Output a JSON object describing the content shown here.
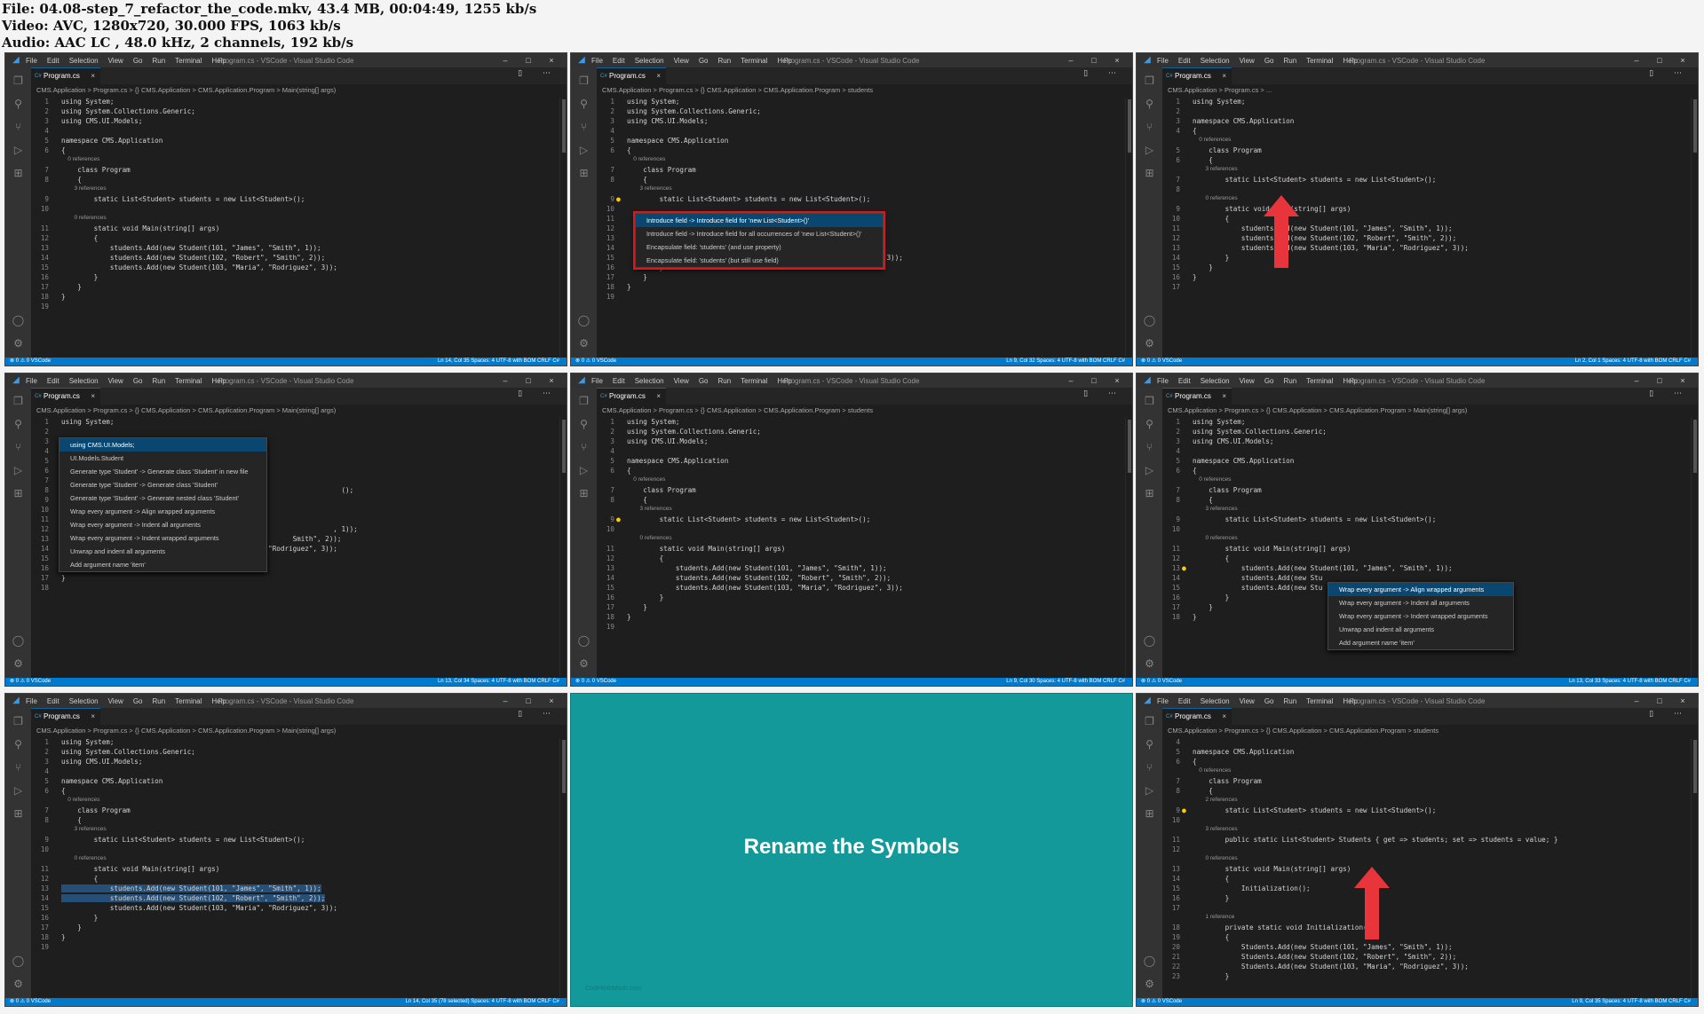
{
  "header": {
    "line1": "File: 04.08-step_7_refactor_the_code.mkv, 43.4 MB, 00:04:49, 1255 kb/s",
    "line2": "Video: AVC, 1280x720, 30.000 FPS, 1063 kb/s",
    "line3": "Audio: AAC LC , 48.0 kHz, 2 channels, 192 kb/s"
  },
  "vscode": {
    "menu": [
      "File",
      "Edit",
      "Selection",
      "View",
      "Go",
      "Run",
      "Terminal",
      "Help"
    ],
    "window_title": "Program.cs - VSCode - Visual Studio Code",
    "tab_label": "Program.cs",
    "tab_close": "×",
    "window_controls": [
      "–",
      "□",
      "×"
    ],
    "logo_glyph": "◢"
  },
  "activity_icons": [
    {
      "name": "explorer-icon",
      "glyph": "❐"
    },
    {
      "name": "search-icon",
      "glyph": "⚲"
    },
    {
      "name": "source-control-icon",
      "glyph": "⑂"
    },
    {
      "name": "run-debug-icon",
      "glyph": "▷"
    },
    {
      "name": "extensions-icon",
      "glyph": "⊞"
    }
  ],
  "activity_bottom": [
    {
      "name": "account-icon",
      "glyph": "◯"
    },
    {
      "name": "settings-gear-icon",
      "glyph": "⚙"
    }
  ],
  "tiles": [
    {
      "breadcrumb": "CMS.Application > Program.cs > {} CMS.Application > CMS.Application.Program > Main(string[] args)",
      "status_left": "⊗ 0 ⚠ 0   VSCode",
      "status_right": "Ln 14, Col 35   Spaces: 4   UTF-8 with BOM   CRLF   C#",
      "lines": [
        {
          "n": "1",
          "t": "using System;"
        },
        {
          "n": "2",
          "t": "using System.Collections.Generic;"
        },
        {
          "n": "3",
          "t": "using CMS.UI.Models;"
        },
        {
          "n": "4",
          "t": ""
        },
        {
          "n": "5",
          "t": "namespace CMS.Application"
        },
        {
          "n": "6",
          "t": "{"
        },
        {
          "n": "",
          "t": "    0 references",
          "ref": true
        },
        {
          "n": "7",
          "t": "    class Program"
        },
        {
          "n": "8",
          "t": "    {"
        },
        {
          "n": "",
          "t": "        3 references",
          "ref": true
        },
        {
          "n": "9",
          "t": "        static List<Student> students = new List<Student>();"
        },
        {
          "n": "10",
          "t": ""
        },
        {
          "n": "",
          "t": "        0 references",
          "ref": true
        },
        {
          "n": "11",
          "t": "        static void Main(string[] args)"
        },
        {
          "n": "12",
          "t": "        {"
        },
        {
          "n": "13",
          "t": "            students.Add(new Student(101, \"James\", \"Smith\", 1));"
        },
        {
          "n": "14",
          "t": "            students.Add(new Student(102, \"Robert\", \"Smith\", 2));"
        },
        {
          "n": "15",
          "t": "            students.Add(new Student(103, \"Maria\", \"Rodriguez\", 3));"
        },
        {
          "n": "16",
          "t": "        }"
        },
        {
          "n": "17",
          "t": "    }"
        },
        {
          "n": "18",
          "t": "}"
        },
        {
          "n": "19",
          "t": ""
        }
      ]
    },
    {
      "breadcrumb": "CMS.Application > Program.cs > {} CMS.Application > CMS.Application.Program > students",
      "status_left": "⊗ 0 ⚠ 0   VSCode",
      "status_right": "Ln 9, Col 32   Spaces: 4   UTF-8 with BOM   CRLF   C#",
      "lines": [
        {
          "n": "1",
          "t": "using System;"
        },
        {
          "n": "2",
          "t": "using System.Collections.Generic;"
        },
        {
          "n": "3",
          "t": "using CMS.UI.Models;"
        },
        {
          "n": "4",
          "t": ""
        },
        {
          "n": "5",
          "t": "namespace CMS.Application"
        },
        {
          "n": "6",
          "t": "{"
        },
        {
          "n": "",
          "t": "    0 references",
          "ref": true
        },
        {
          "n": "7",
          "t": "    class Program"
        },
        {
          "n": "8",
          "t": "    {"
        },
        {
          "n": "",
          "t": "        3 references",
          "ref": true
        },
        {
          "n": "9",
          "t": "        static List<Student> students = new List<Student>();",
          "bulb": true
        },
        {
          "n": "10",
          "t": ""
        },
        {
          "n": "11",
          "t": ""
        },
        {
          "n": "12",
          "t": ""
        },
        {
          "n": "13",
          "t": ""
        },
        {
          "n": "14",
          "t": ""
        },
        {
          "n": "15",
          "t": "            students.Add(new Student(103, \"Maria\", \"Rodriguez\", 3));"
        },
        {
          "n": "16",
          "t": "        }"
        },
        {
          "n": "17",
          "t": "    }"
        },
        {
          "n": "18",
          "t": "}"
        },
        {
          "n": "19",
          "t": ""
        }
      ],
      "menu": [
        "Introduce field -> Introduce field for 'new List<Student>()'",
        "Introduce field -> Introduce field for all occurrences of 'new List<Student>()'",
        "Encapsulate field: 'students' (and use property)",
        "Encapsulate field: 'students' (but still use field)"
      ]
    },
    {
      "breadcrumb": "CMS.Application > Program.cs > ...",
      "status_left": "⊗ 0 ⚠ 0   VSCode",
      "status_right": "Ln 2, Col 1   Spaces: 4   UTF-8 with BOM   CRLF   C#",
      "lines": [
        {
          "n": "1",
          "t": "using System;"
        },
        {
          "n": "2",
          "t": ""
        },
        {
          "n": "3",
          "t": "namespace CMS.Application"
        },
        {
          "n": "4",
          "t": "{"
        },
        {
          "n": "",
          "t": "    0 references",
          "ref": true
        },
        {
          "n": "5",
          "t": "    class Program"
        },
        {
          "n": "6",
          "t": "    {"
        },
        {
          "n": "",
          "t": "        3 references",
          "ref": true
        },
        {
          "n": "7",
          "t": "        static List<Student> students = new List<Student>();"
        },
        {
          "n": "8",
          "t": ""
        },
        {
          "n": "",
          "t": "        0 references",
          "ref": true
        },
        {
          "n": "9",
          "t": "        static void Main(string[] args)"
        },
        {
          "n": "10",
          "t": "        {"
        },
        {
          "n": "11",
          "t": "            students.Add(new Student(101, \"James\", \"Smith\", 1));"
        },
        {
          "n": "12",
          "t": "            students.Add(new Student(102, \"Robert\", \"Smith\", 2));"
        },
        {
          "n": "13",
          "t": "            students.Add(new Student(103, \"Maria\", \"Rodriguez\", 3));"
        },
        {
          "n": "14",
          "t": "        }"
        },
        {
          "n": "15",
          "t": "    }"
        },
        {
          "n": "16",
          "t": "}"
        },
        {
          "n": "17",
          "t": ""
        }
      ]
    },
    {
      "breadcrumb": "CMS.Application > Program.cs > {} CMS.Application > CMS.Application.Program > Main(string[] args)",
      "status_left": "⊗ 0 ⚠ 0   VSCode",
      "status_right": "Ln 13, Col 34   Spaces: 4   UTF-8 with BOM   CRLF   C#",
      "lines": [
        {
          "n": "1",
          "t": "using System;"
        },
        {
          "n": "2",
          "t": ""
        },
        {
          "n": "3",
          "t": ""
        },
        {
          "n": "4",
          "t": ""
        },
        {
          "n": "5",
          "t": ""
        },
        {
          "n": "6",
          "t": ""
        },
        {
          "n": "7",
          "t": ""
        },
        {
          "n": "8",
          "t": "                                                                     ();"
        },
        {
          "n": "9",
          "t": ""
        },
        {
          "n": "10",
          "t": ""
        },
        {
          "n": "11",
          "t": ""
        },
        {
          "n": "12",
          "t": "                                                                   , 1));"
        },
        {
          "n": "13",
          "t": "                                                         Smith\", 2));"
        },
        {
          "n": "14",
          "t": "            students.Add(new Student(103, \"Maria\", \"Rodriguez\", 3));"
        },
        {
          "n": "15",
          "t": "        }"
        },
        {
          "n": "16",
          "t": "    }"
        },
        {
          "n": "17",
          "t": "}"
        },
        {
          "n": "18",
          "t": ""
        }
      ],
      "menu": [
        "using CMS.UI.Models;",
        "UI.Models.Student",
        "Generate type 'Student' -> Generate class 'Student' in new file",
        "Generate type 'Student' -> Generate class 'Student'",
        "Generate type 'Student' -> Generate nested class 'Student'",
        "Wrap every argument -> Align wrapped arguments",
        "Wrap every argument -> Indent all arguments",
        "Wrap every argument -> Indent wrapped arguments",
        "Unwrap and indent all arguments",
        "Add argument name 'item'"
      ]
    },
    {
      "breadcrumb": "CMS.Application > Program.cs > {} CMS.Application > CMS.Application.Program > students",
      "status_left": "⊗ 0 ⚠ 0   VSCode",
      "status_right": "Ln 9, Col 30   Spaces: 4   UTF-8 with BOM   CRLF   C#",
      "lines": [
        {
          "n": "1",
          "t": "using System;"
        },
        {
          "n": "2",
          "t": "using System.Collections.Generic;"
        },
        {
          "n": "3",
          "t": "using CMS.UI.Models;"
        },
        {
          "n": "4",
          "t": ""
        },
        {
          "n": "5",
          "t": "namespace CMS.Application"
        },
        {
          "n": "6",
          "t": "{"
        },
        {
          "n": "",
          "t": "    0 references",
          "ref": true
        },
        {
          "n": "7",
          "t": "    class Program"
        },
        {
          "n": "8",
          "t": "    {"
        },
        {
          "n": "",
          "t": "        3 references",
          "ref": true
        },
        {
          "n": "9",
          "t": "        static List<Student> students = new List<Student>();",
          "bulb": true
        },
        {
          "n": "10",
          "t": ""
        },
        {
          "n": "",
          "t": "        0 references",
          "ref": true
        },
        {
          "n": "11",
          "t": "        static void Main(string[] args)"
        },
        {
          "n": "12",
          "t": "        {"
        },
        {
          "n": "13",
          "t": "            students.Add(new Student(101, \"James\", \"Smith\", 1));"
        },
        {
          "n": "14",
          "t": "            students.Add(new Student(102, \"Robert\", \"Smith\", 2));"
        },
        {
          "n": "15",
          "t": "            students.Add(new Student(103, \"Maria\", \"Rodriguez\", 3));"
        },
        {
          "n": "16",
          "t": "        }"
        },
        {
          "n": "17",
          "t": "    }"
        },
        {
          "n": "18",
          "t": "}"
        },
        {
          "n": "19",
          "t": ""
        }
      ]
    },
    {
      "breadcrumb": "CMS.Application > Program.cs > {} CMS.Application > CMS.Application.Program > Main(string[] args)",
      "status_left": "⊗ 0 ⚠ 0   VSCode",
      "status_right": "Ln 13, Col 33   Spaces: 4   UTF-8 with BOM   CRLF   C#",
      "lines": [
        {
          "n": "1",
          "t": "using System;"
        },
        {
          "n": "2",
          "t": "using System.Collections.Generic;"
        },
        {
          "n": "3",
          "t": "using CMS.UI.Models;"
        },
        {
          "n": "4",
          "t": ""
        },
        {
          "n": "5",
          "t": "namespace CMS.Application"
        },
        {
          "n": "6",
          "t": "{"
        },
        {
          "n": "",
          "t": "    0 references",
          "ref": true
        },
        {
          "n": "7",
          "t": "    class Program"
        },
        {
          "n": "8",
          "t": "    {"
        },
        {
          "n": "",
          "t": "        3 references",
          "ref": true
        },
        {
          "n": "9",
          "t": "        static List<Student> students = new List<Student>();"
        },
        {
          "n": "10",
          "t": ""
        },
        {
          "n": "",
          "t": "        0 references",
          "ref": true
        },
        {
          "n": "11",
          "t": "        static void Main(string[] args)"
        },
        {
          "n": "12",
          "t": "        {"
        },
        {
          "n": "13",
          "t": "            students.Add(new Student(101, \"James\", \"Smith\", 1));",
          "bulb": true
        },
        {
          "n": "14",
          "t": "            students.Add(new Stu"
        },
        {
          "n": "15",
          "t": "            students.Add(new Stu"
        },
        {
          "n": "16",
          "t": "        }"
        },
        {
          "n": "17",
          "t": "    }"
        },
        {
          "n": "18",
          "t": "}"
        }
      ],
      "menu": [
        "Wrap every argument -> Align wrapped arguments",
        "Wrap every argument -> Indent all arguments",
        "Wrap every argument -> Indent wrapped arguments",
        "Unwrap and indent all arguments",
        "Add argument name 'item'"
      ]
    },
    {
      "breadcrumb": "CMS.Application > Program.cs > {} CMS.Application > CMS.Application.Program > Main(string[] args)",
      "status_left": "⊗ 0 ⚠ 0   VSCode",
      "status_right": "Ln 14, Col 35 (78 selected)   Spaces: 4   UTF-8 with BOM   CRLF   C#",
      "lines": [
        {
          "n": "1",
          "t": "using System;"
        },
        {
          "n": "2",
          "t": "using System.Collections.Generic;"
        },
        {
          "n": "3",
          "t": "using CMS.UI.Models;"
        },
        {
          "n": "4",
          "t": ""
        },
        {
          "n": "5",
          "t": "namespace CMS.Application"
        },
        {
          "n": "6",
          "t": "{"
        },
        {
          "n": "",
          "t": "    0 references",
          "ref": true
        },
        {
          "n": "7",
          "t": "    class Program"
        },
        {
          "n": "8",
          "t": "    {"
        },
        {
          "n": "",
          "t": "        3 references",
          "ref": true
        },
        {
          "n": "9",
          "t": "        static List<Student> students = new List<Student>();"
        },
        {
          "n": "10",
          "t": ""
        },
        {
          "n": "",
          "t": "        0 references",
          "ref": true
        },
        {
          "n": "11",
          "t": "        static void Main(string[] args)"
        },
        {
          "n": "12",
          "t": "        {"
        },
        {
          "n": "13",
          "t": "            students.Add(new Student(101, \"James\", \"Smith\", 1));",
          "sel": true
        },
        {
          "n": "14",
          "t": "            students.Add(new Student(102, \"Robert\", \"Smith\", 2));",
          "sel": true
        },
        {
          "n": "15",
          "t": "            students.Add(new Student(103, \"Maria\", \"Rodriguez\", 3));"
        },
        {
          "n": "16",
          "t": "        }"
        },
        {
          "n": "17",
          "t": "    }"
        },
        {
          "n": "18",
          "t": "}"
        },
        {
          "n": "19",
          "t": ""
        }
      ]
    },
    {
      "title": "Rename the Symbols",
      "footer": "CodeWithMosh.com"
    },
    {
      "breadcrumb": "CMS.Application > Program.cs > {} CMS.Application > CMS.Application.Program > students",
      "status_left": "⊗ 0 ⚠ 0   VSCode",
      "status_right": "Ln 9, Col 35   Spaces: 4   UTF-8 with BOM   CRLF   C#",
      "lines": [
        {
          "n": "4",
          "t": ""
        },
        {
          "n": "5",
          "t": "namespace CMS.Application"
        },
        {
          "n": "6",
          "t": "{"
        },
        {
          "n": "",
          "t": "    0 references",
          "ref": true
        },
        {
          "n": "7",
          "t": "    class Program"
        },
        {
          "n": "8",
          "t": "    {"
        },
        {
          "n": "",
          "t": "        2 references",
          "ref": true
        },
        {
          "n": "9",
          "t": "        static List<Student> students = new List<Student>();",
          "bulb": true
        },
        {
          "n": "10",
          "t": ""
        },
        {
          "n": "",
          "t": "        3 references",
          "ref": true
        },
        {
          "n": "11",
          "t": "        public static List<Student> Students { get => students; set => students = value; }"
        },
        {
          "n": "12",
          "t": ""
        },
        {
          "n": "",
          "t": "        0 references",
          "ref": true
        },
        {
          "n": "13",
          "t": "        static void Main(string[] args)"
        },
        {
          "n": "14",
          "t": "        {"
        },
        {
          "n": "15",
          "t": "            Initialization();"
        },
        {
          "n": "16",
          "t": "        }"
        },
        {
          "n": "17",
          "t": ""
        },
        {
          "n": "",
          "t": "        1 reference",
          "ref": true
        },
        {
          "n": "18",
          "t": "        private static void Initialization()"
        },
        {
          "n": "19",
          "t": "        {"
        },
        {
          "n": "20",
          "t": "            Students.Add(new Student(101, \"James\", \"Smith\", 1));"
        },
        {
          "n": "21",
          "t": "            Students.Add(new Student(102, \"Robert\", \"Smith\", 2));"
        },
        {
          "n": "22",
          "t": "            Students.Add(new Student(103, \"Maria\", \"Rodriguez\", 3));"
        },
        {
          "n": "23",
          "t": "        }"
        }
      ]
    }
  ],
  "colors": {
    "highlight_box": "#e0141b",
    "arrow": "#e8353b",
    "teal": "#14999a",
    "statusbar": "#007acc"
  }
}
